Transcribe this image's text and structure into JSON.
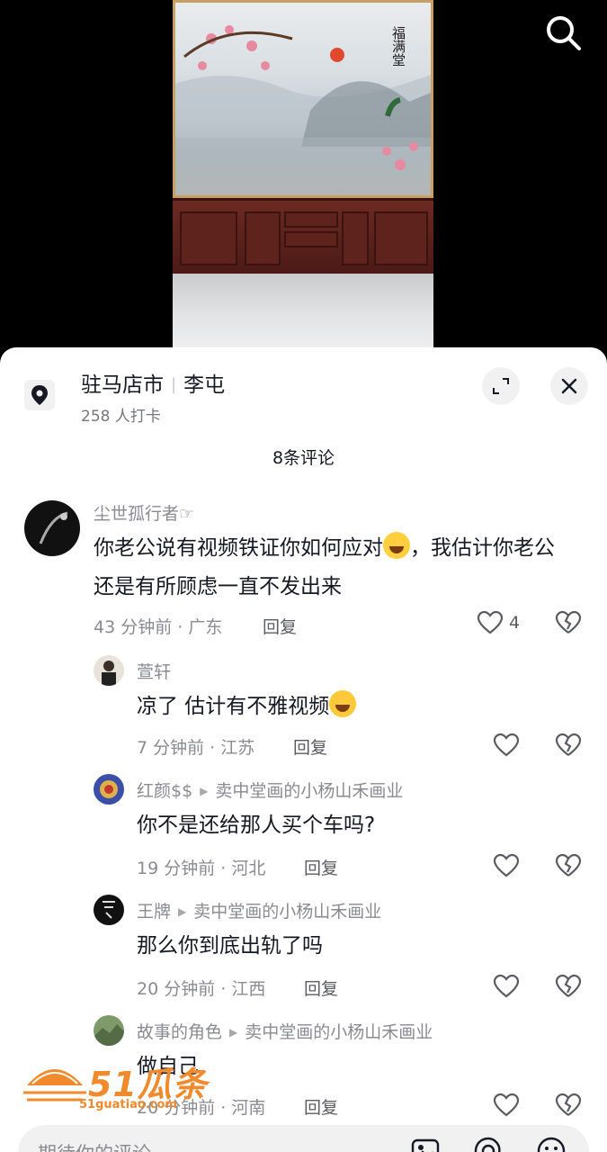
{
  "location": {
    "city": "驻马店市",
    "place": "李屯",
    "checkins": "258 人打卡"
  },
  "comments_count": "8条评论",
  "comments": [
    {
      "user": "尘世孤行者☞",
      "text": "你老公说有视频铁证你如何应对",
      "text2": "，我估计你老公还是有所顾虑一直不发出来",
      "time": "43 分钟前 · 广东",
      "reply": "回复",
      "likes": "4"
    },
    {
      "user": "萱轩",
      "text": "凉了 估计有不雅视频",
      "time": "7 分钟前 · 江苏",
      "reply": "回复",
      "likes": ""
    },
    {
      "user": "红颜$$",
      "reply_to": "卖中堂画的小杨山禾画业",
      "text": "你不是还给那人买个车吗?",
      "time": "19 分钟前 · 河北",
      "reply": "回复",
      "likes": ""
    },
    {
      "user": "王牌",
      "reply_to": "卖中堂画的小杨山禾画业",
      "text": "那么你到底出轨了吗",
      "time": "20 分钟前 · 江西",
      "reply": "回复",
      "likes": ""
    },
    {
      "user": "故事的角色",
      "reply_to": "卖中堂画的小杨山禾画业",
      "text": "做自己",
      "time": "20 分钟前 · 河南",
      "reply": "回复",
      "likes": ""
    }
  ],
  "input": {
    "placeholder": "期待你的评论"
  },
  "painting": {
    "title": "福满堂"
  },
  "watermark": {
    "brand": "51瓜条",
    "url": "51guatiao.com"
  },
  "colors": {
    "accent": "#f08a2c",
    "text": "#161823",
    "muted": "#8a8b91"
  }
}
